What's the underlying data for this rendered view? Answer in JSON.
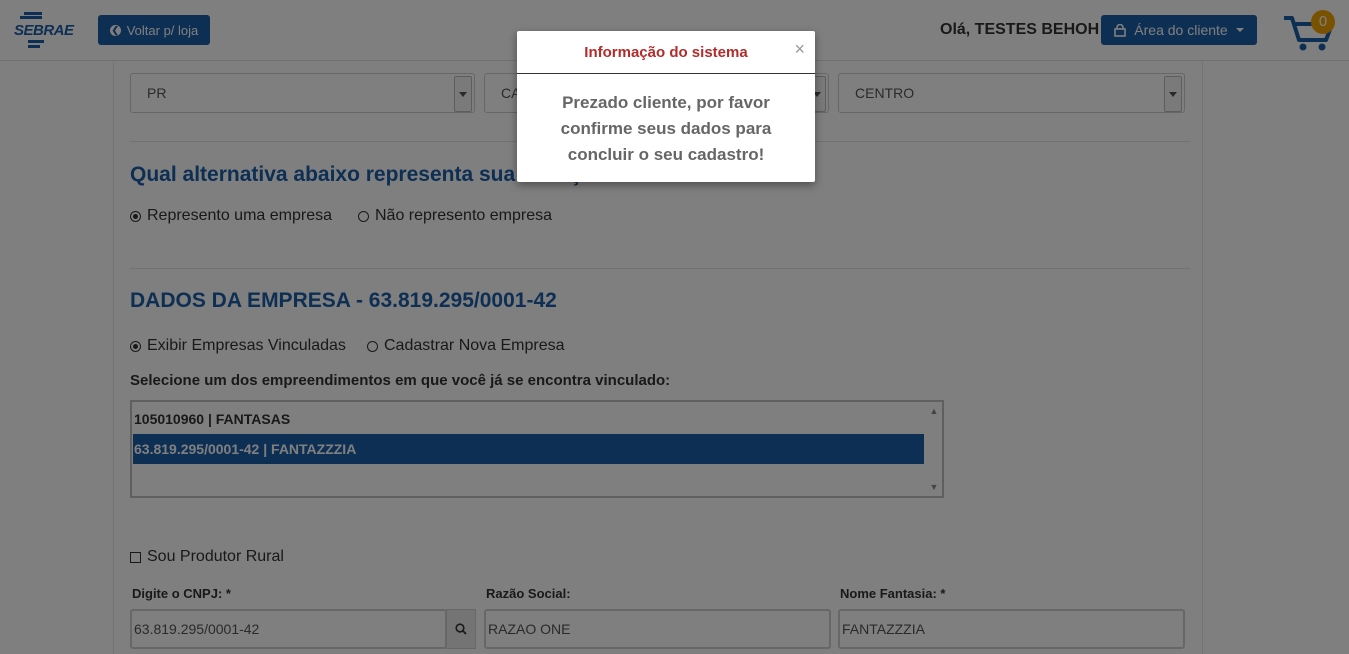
{
  "header": {
    "logo_text": "SEBRAE",
    "back_button": "Voltar p/ loja",
    "greeting": "Olá, TESTES BEHOH",
    "client_area_button": "Área do cliente",
    "cart_count": "0"
  },
  "address": {
    "state_value": "PR",
    "city_value": "CAM",
    "district_value": "CENTRO"
  },
  "situation": {
    "title": "Qual alternativa abaixo representa sua situação atual?",
    "options": [
      "Represento uma empresa",
      "Não represento empresa"
    ],
    "selected": "Represento uma empresa"
  },
  "company": {
    "title": "DADOS DA EMPRESA - 63.819.295/0001-42",
    "options": [
      "Exibir Empresas Vinculadas",
      "Cadastrar Nova Empresa"
    ],
    "selected": "Exibir Empresas Vinculadas",
    "select_prompt": "Selecione um dos empreendimentos em que você já se encontra vinculado:",
    "list": [
      {
        "label": "105010960 | FANTASAS",
        "selected": false
      },
      {
        "label": "63.819.295/0001-42 | FANTAZZZIA",
        "selected": true
      }
    ],
    "rural_label": "Sou Produtor Rural",
    "cnpj_label": "Digite o CNPJ: *",
    "cnpj_value": "63.819.295/0001-42",
    "razao_label": "Razão Social:",
    "razao_value": "RAZAO ONE",
    "fantasia_label": "Nome Fantasia: *",
    "fantasia_value": "FANTAZZZIA"
  },
  "modal": {
    "title": "Informação do sistema",
    "close_symbol": "×",
    "message": "Prezado cliente, por favor confirme seus dados para concluir o seu cadastro!"
  },
  "colors": {
    "brand_blue": "#1d5fa8",
    "cart_badge": "#f0a500",
    "modal_title": "#b22c2c"
  }
}
